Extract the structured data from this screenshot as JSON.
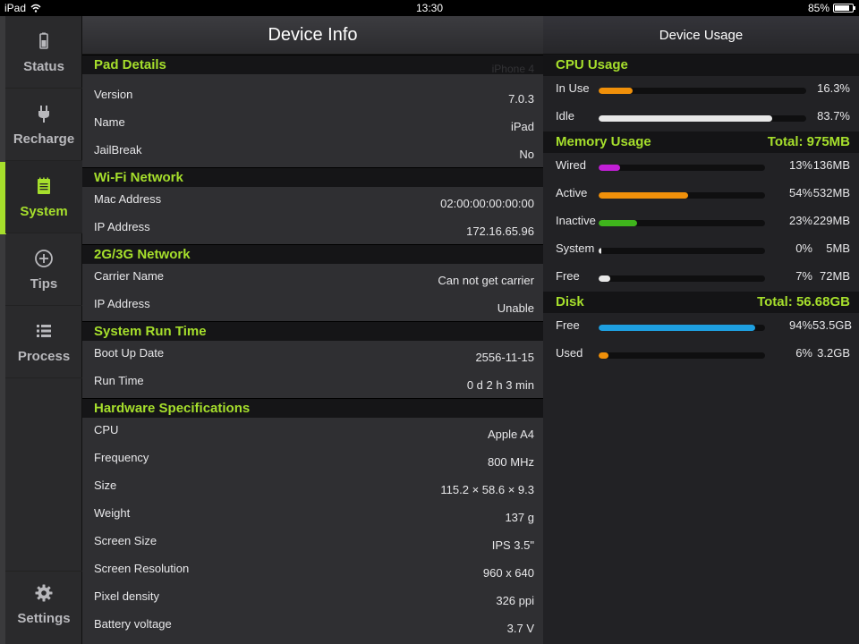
{
  "status_bar": {
    "device": "iPad",
    "time": "13:30",
    "battery": "85%",
    "battery_level": 0.85
  },
  "sidebar": {
    "items": [
      {
        "label": "Status",
        "icon": "battery-icon"
      },
      {
        "label": "Recharge",
        "icon": "plug-icon"
      },
      {
        "label": "System",
        "icon": "notepad-icon",
        "active": true
      },
      {
        "label": "Tips",
        "icon": "plus-circle-icon"
      },
      {
        "label": "Process",
        "icon": "list-icon"
      }
    ],
    "settings": {
      "label": "Settings",
      "icon": "gear-icon"
    }
  },
  "device_info": {
    "title": "Device Info",
    "ghost_text": "iPhone 4",
    "sections": [
      {
        "title": "Pad Details",
        "rows": [
          {
            "label": "Version",
            "value": "7.0.3"
          },
          {
            "label": "Name",
            "value": "iPad"
          },
          {
            "label": "JailBreak",
            "value": "No"
          }
        ]
      },
      {
        "title": "Wi-Fi Network",
        "rows": [
          {
            "label": "Mac Address",
            "value": "02:00:00:00:00:00"
          },
          {
            "label": "IP Address",
            "value": "172.16.65.96"
          }
        ]
      },
      {
        "title": "2G/3G Network",
        "rows": [
          {
            "label": "Carrier Name",
            "value": "Can not get carrier"
          },
          {
            "label": "IP Address",
            "value": "Unable"
          }
        ]
      },
      {
        "title": "System Run Time",
        "rows": [
          {
            "label": "Boot Up Date",
            "value": "2556-11-15"
          },
          {
            "label": "Run Time",
            "value": "0 d 2 h 3 min"
          }
        ]
      },
      {
        "title": "Hardware Specifications",
        "rows": [
          {
            "label": "CPU",
            "value": "Apple A4"
          },
          {
            "label": "Frequency",
            "value": "800 MHz"
          },
          {
            "label": "Size",
            "value": "115.2 × 58.6 × 9.3"
          },
          {
            "label": "Weight",
            "value": "137 g"
          },
          {
            "label": "Screen Size",
            "value": "IPS 3.5\""
          },
          {
            "label": "Screen Resolution",
            "value": "960 x 640"
          },
          {
            "label": "Pixel density",
            "value": "326 ppi"
          },
          {
            "label": "Battery voltage",
            "value": "3.7 V"
          }
        ]
      }
    ]
  },
  "device_usage": {
    "title": "Device Usage",
    "cpu": {
      "title": "CPU Usage",
      "rows": [
        {
          "label": "In Use",
          "value": "16.3%",
          "fraction": 0.163,
          "color": "#f0900a"
        },
        {
          "label": "Idle",
          "value": "83.7%",
          "fraction": 0.837,
          "color": "#e8e8e8"
        }
      ]
    },
    "memory": {
      "title": "Memory Usage",
      "total": "Total: 975MB",
      "rows": [
        {
          "label": "Wired",
          "pct": "13%",
          "size": "136MB",
          "fraction": 0.13,
          "color": "#c21fd6"
        },
        {
          "label": "Active",
          "pct": "54%",
          "size": "532MB",
          "fraction": 0.54,
          "color": "#f0900a"
        },
        {
          "label": "Inactive",
          "pct": "23%",
          "size": "229MB",
          "fraction": 0.23,
          "color": "#3fb51c"
        },
        {
          "label": "System",
          "pct": "0%",
          "size": "5MB",
          "fraction": 0.005,
          "color": "#e8e8e8"
        },
        {
          "label": "Free",
          "pct": "7%",
          "size": "72MB",
          "fraction": 0.07,
          "color": "#e8e8e8"
        }
      ]
    },
    "disk": {
      "title": "Disk",
      "total": "Total: 56.68GB",
      "rows": [
        {
          "label": "Free",
          "pct": "94%",
          "size": "53.5GB",
          "fraction": 0.94,
          "color": "#1e9fe0"
        },
        {
          "label": "Used",
          "pct": "6%",
          "size": "3.2GB",
          "fraction": 0.06,
          "color": "#f0900a"
        }
      ]
    }
  }
}
